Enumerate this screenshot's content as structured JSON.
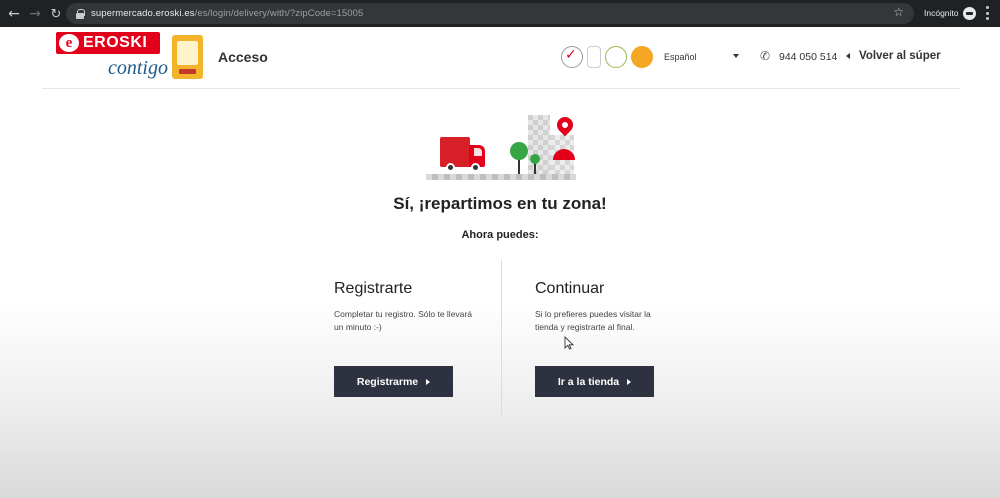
{
  "browser": {
    "url_host": "supermercado.eroski.es",
    "url_path": "/es/login/delivery/with/?zipCode=15005",
    "incognito_label": "Incógnito"
  },
  "header": {
    "brand": "EROSKI",
    "brand_sub": "contigo",
    "page_title": "Acceso",
    "language": "Español",
    "phone": "944 050 514",
    "back_link": "Volver al súper",
    "brand_color": "#e2001a"
  },
  "main": {
    "headline": "Sí, ¡repartimos en tu zona!",
    "subline": "Ahora puedes:",
    "register": {
      "title": "Registrarte",
      "text": "Completar tu registro. Sólo te llevará un minuto :-)",
      "button": "Registrarme"
    },
    "continue": {
      "title": "Continuar",
      "text": "Si lo prefieres puedes visitar la tienda y registrarte al final.",
      "button": "Ir a la tienda"
    },
    "button_color": "#2e3240"
  }
}
